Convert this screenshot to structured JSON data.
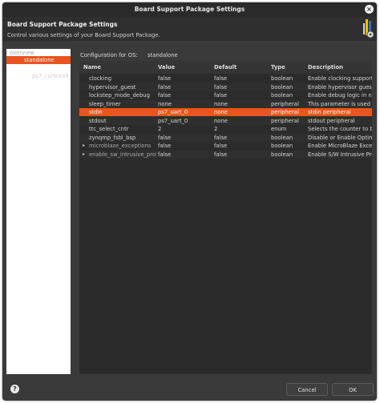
{
  "window": {
    "title": "Board Support Package Settings"
  },
  "header": {
    "title": "Board Support Package Settings",
    "description": "Control various settings of your Board Support Package."
  },
  "sidebar": {
    "items": [
      {
        "label": "overview",
        "state": "faded"
      },
      {
        "label": "standalone",
        "state": "selected"
      },
      {
        "label": "ps7_cortexa9_0",
        "state": "faded"
      }
    ]
  },
  "config": {
    "label": "Configuration for OS:",
    "os": "standalone"
  },
  "table": {
    "headers": {
      "name": "Name",
      "value": "Value",
      "default": "Default",
      "type": "Type",
      "description": "Description"
    },
    "rows": [
      {
        "name": "clocking",
        "value": "false",
        "default": "false",
        "type": "boolean",
        "description": "Enable clocking support"
      },
      {
        "name": "hypervisor_guest",
        "value": "false",
        "default": "false",
        "type": "boolean",
        "description": "Enable hypervisor guest su"
      },
      {
        "name": "lockstep_mode_debug",
        "value": "false",
        "default": "false",
        "type": "boolean",
        "description": "Enable debug logic in non-"
      },
      {
        "name": "sleep_timer",
        "value": "none",
        "default": "none",
        "type": "peripheral",
        "description": "This parameter is used to s"
      },
      {
        "name": "stdin",
        "value": "ps7_uart_0",
        "default": "none",
        "type": "peripheral",
        "description": "stdin peripheral",
        "selected": true
      },
      {
        "name": "stdout",
        "value": "ps7_uart_0",
        "default": "none",
        "type": "peripheral",
        "description": "stdout peripheral"
      },
      {
        "name": "ttc_select_cntr",
        "value": "2",
        "default": "2",
        "type": "enum",
        "description": "Selects the counter to be u"
      },
      {
        "name": "zynqmp_fsbl_bsp",
        "value": "false",
        "default": "false",
        "type": "boolean",
        "description": "Disable or Enable Optimiz"
      },
      {
        "name": "microblaze_exceptions",
        "value": "false",
        "default": "false",
        "type": "boolean",
        "description": "Enable MicroBlaze Excepti",
        "expandable": true
      },
      {
        "name": "enable_sw_intrusive_profi",
        "value": "false",
        "default": "false",
        "type": "boolean",
        "description": "Enable S/W Intrusive Profil",
        "expandable": true
      }
    ]
  },
  "footer": {
    "help_icon": "question-icon",
    "cancel_label": "Cancel",
    "ok_label": "OK"
  },
  "colors": {
    "accent": "#e95420",
    "background": "#3a3a3a",
    "table_bg": "#2b2b2b"
  }
}
